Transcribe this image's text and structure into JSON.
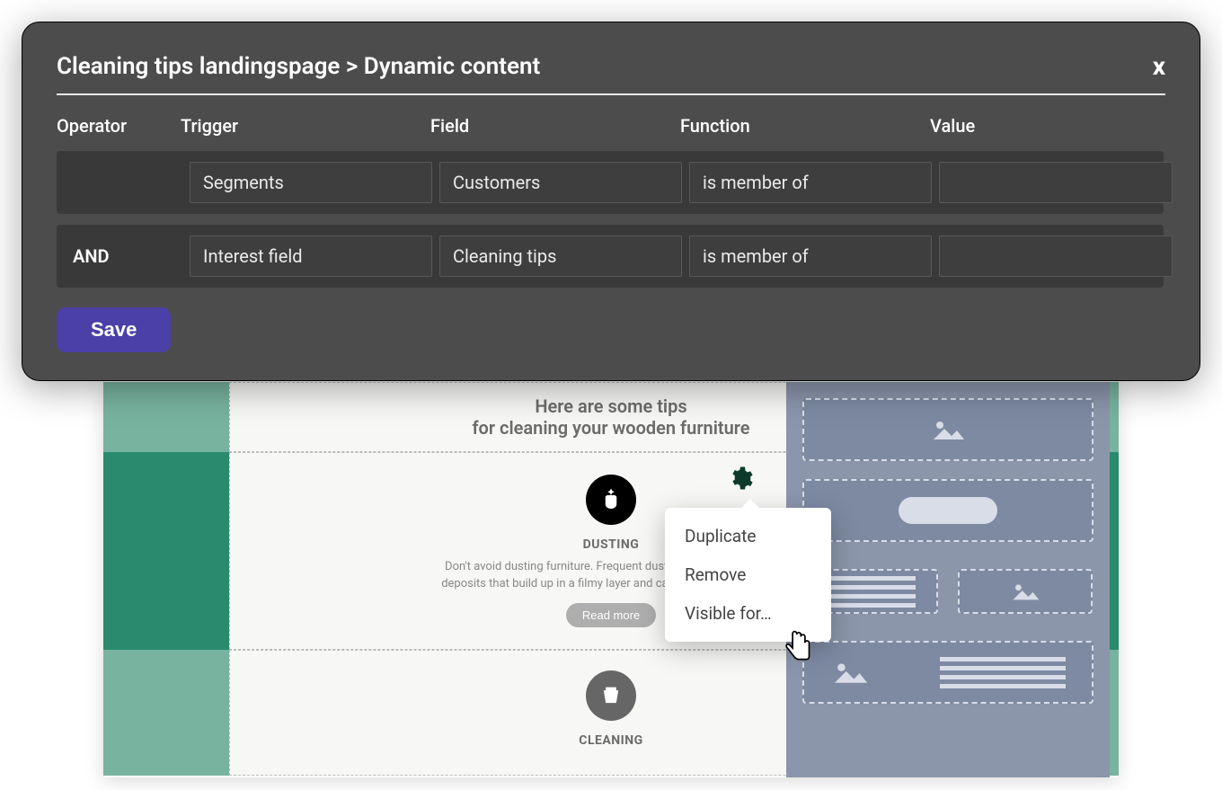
{
  "dialog": {
    "title": "Cleaning tips landingspage > Dynamic content",
    "close": "x",
    "columns": {
      "operator": "Operator",
      "trigger": "Trigger",
      "field": "Field",
      "function": "Function",
      "value": "Value"
    },
    "rows": [
      {
        "operator": "",
        "trigger": "Segments",
        "field": "Customers",
        "function": "is member of",
        "value": ""
      },
      {
        "operator": "AND",
        "trigger": "Interest field",
        "field": "Cleaning tips",
        "function": "is member of",
        "value": ""
      }
    ],
    "save": "Save"
  },
  "canvas": {
    "heading_line1": "Here are some tips",
    "heading_line2": "for cleaning your wooden furniture",
    "dusting": {
      "label": "DUSTING",
      "desc": "Don't avoid dusting furniture. Frequent dusting removes airborne deposits that build up in a filmy layer and can scratch the surface.",
      "button": "Read more"
    },
    "cleaning": {
      "label": "CLEANING"
    }
  },
  "context_menu": {
    "duplicate": "Duplicate",
    "remove": "Remove",
    "visible_for": "Visible for…"
  }
}
